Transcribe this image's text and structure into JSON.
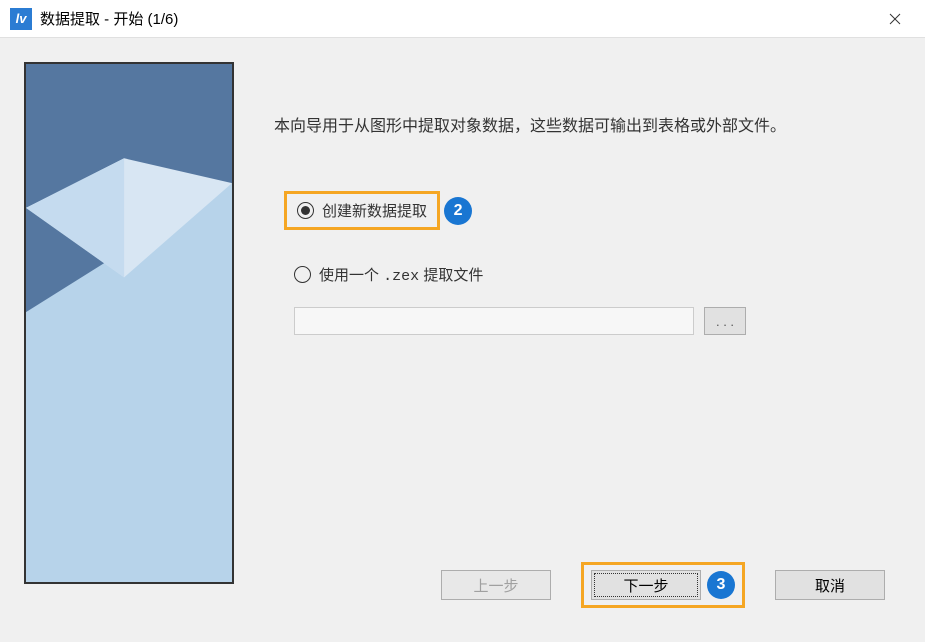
{
  "window": {
    "title": "数据提取 - 开始 (1/6)",
    "app_icon_glyph": "lv"
  },
  "description": "本向导用于从图形中提取对象数据，这些数据可输出到表格或外部文件。",
  "options": {
    "create_new": "创建新数据提取",
    "use_file_prefix": "使用一个 ",
    "use_file_ext": ".zex",
    "use_file_suffix": " 提取文件"
  },
  "file": {
    "value": "",
    "browse_label": ". . ."
  },
  "buttons": {
    "back": "上一步",
    "next": "下一步",
    "cancel": "取消"
  },
  "annotations": {
    "badge2": "2",
    "badge3": "3"
  }
}
